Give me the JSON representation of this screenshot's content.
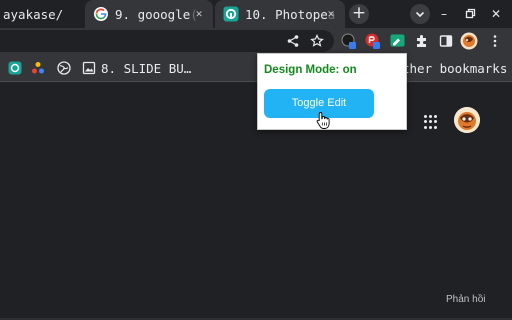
{
  "tabs": [
    {
      "label": "ayakase/",
      "fade": "/",
      "active": false
    },
    {
      "label": "9. gooogle",
      "fade": "(",
      "active": false,
      "close": "✕"
    },
    {
      "label": "10. Photope",
      "fade": "a",
      "active": true,
      "close": "✕"
    }
  ],
  "tabstrip": {
    "new_tab": "+"
  },
  "window_controls": {
    "minimize": "–",
    "restore": "▫",
    "close": "✕"
  },
  "bookmarks": {
    "items": [
      {
        "label": "8. SLIDE BU…",
        "icon": "image-icon"
      }
    ],
    "other_label": "ther bookmarks"
  },
  "popup": {
    "status": "Design Mode: on",
    "button_label": "Toggle Edit"
  },
  "page": {
    "feedback": "Phản hồi"
  },
  "colors": {
    "popup_button": "#22b3f5",
    "status_text": "#118c1b",
    "page_bg": "#202124",
    "toolbar_bg": "#35363a"
  }
}
